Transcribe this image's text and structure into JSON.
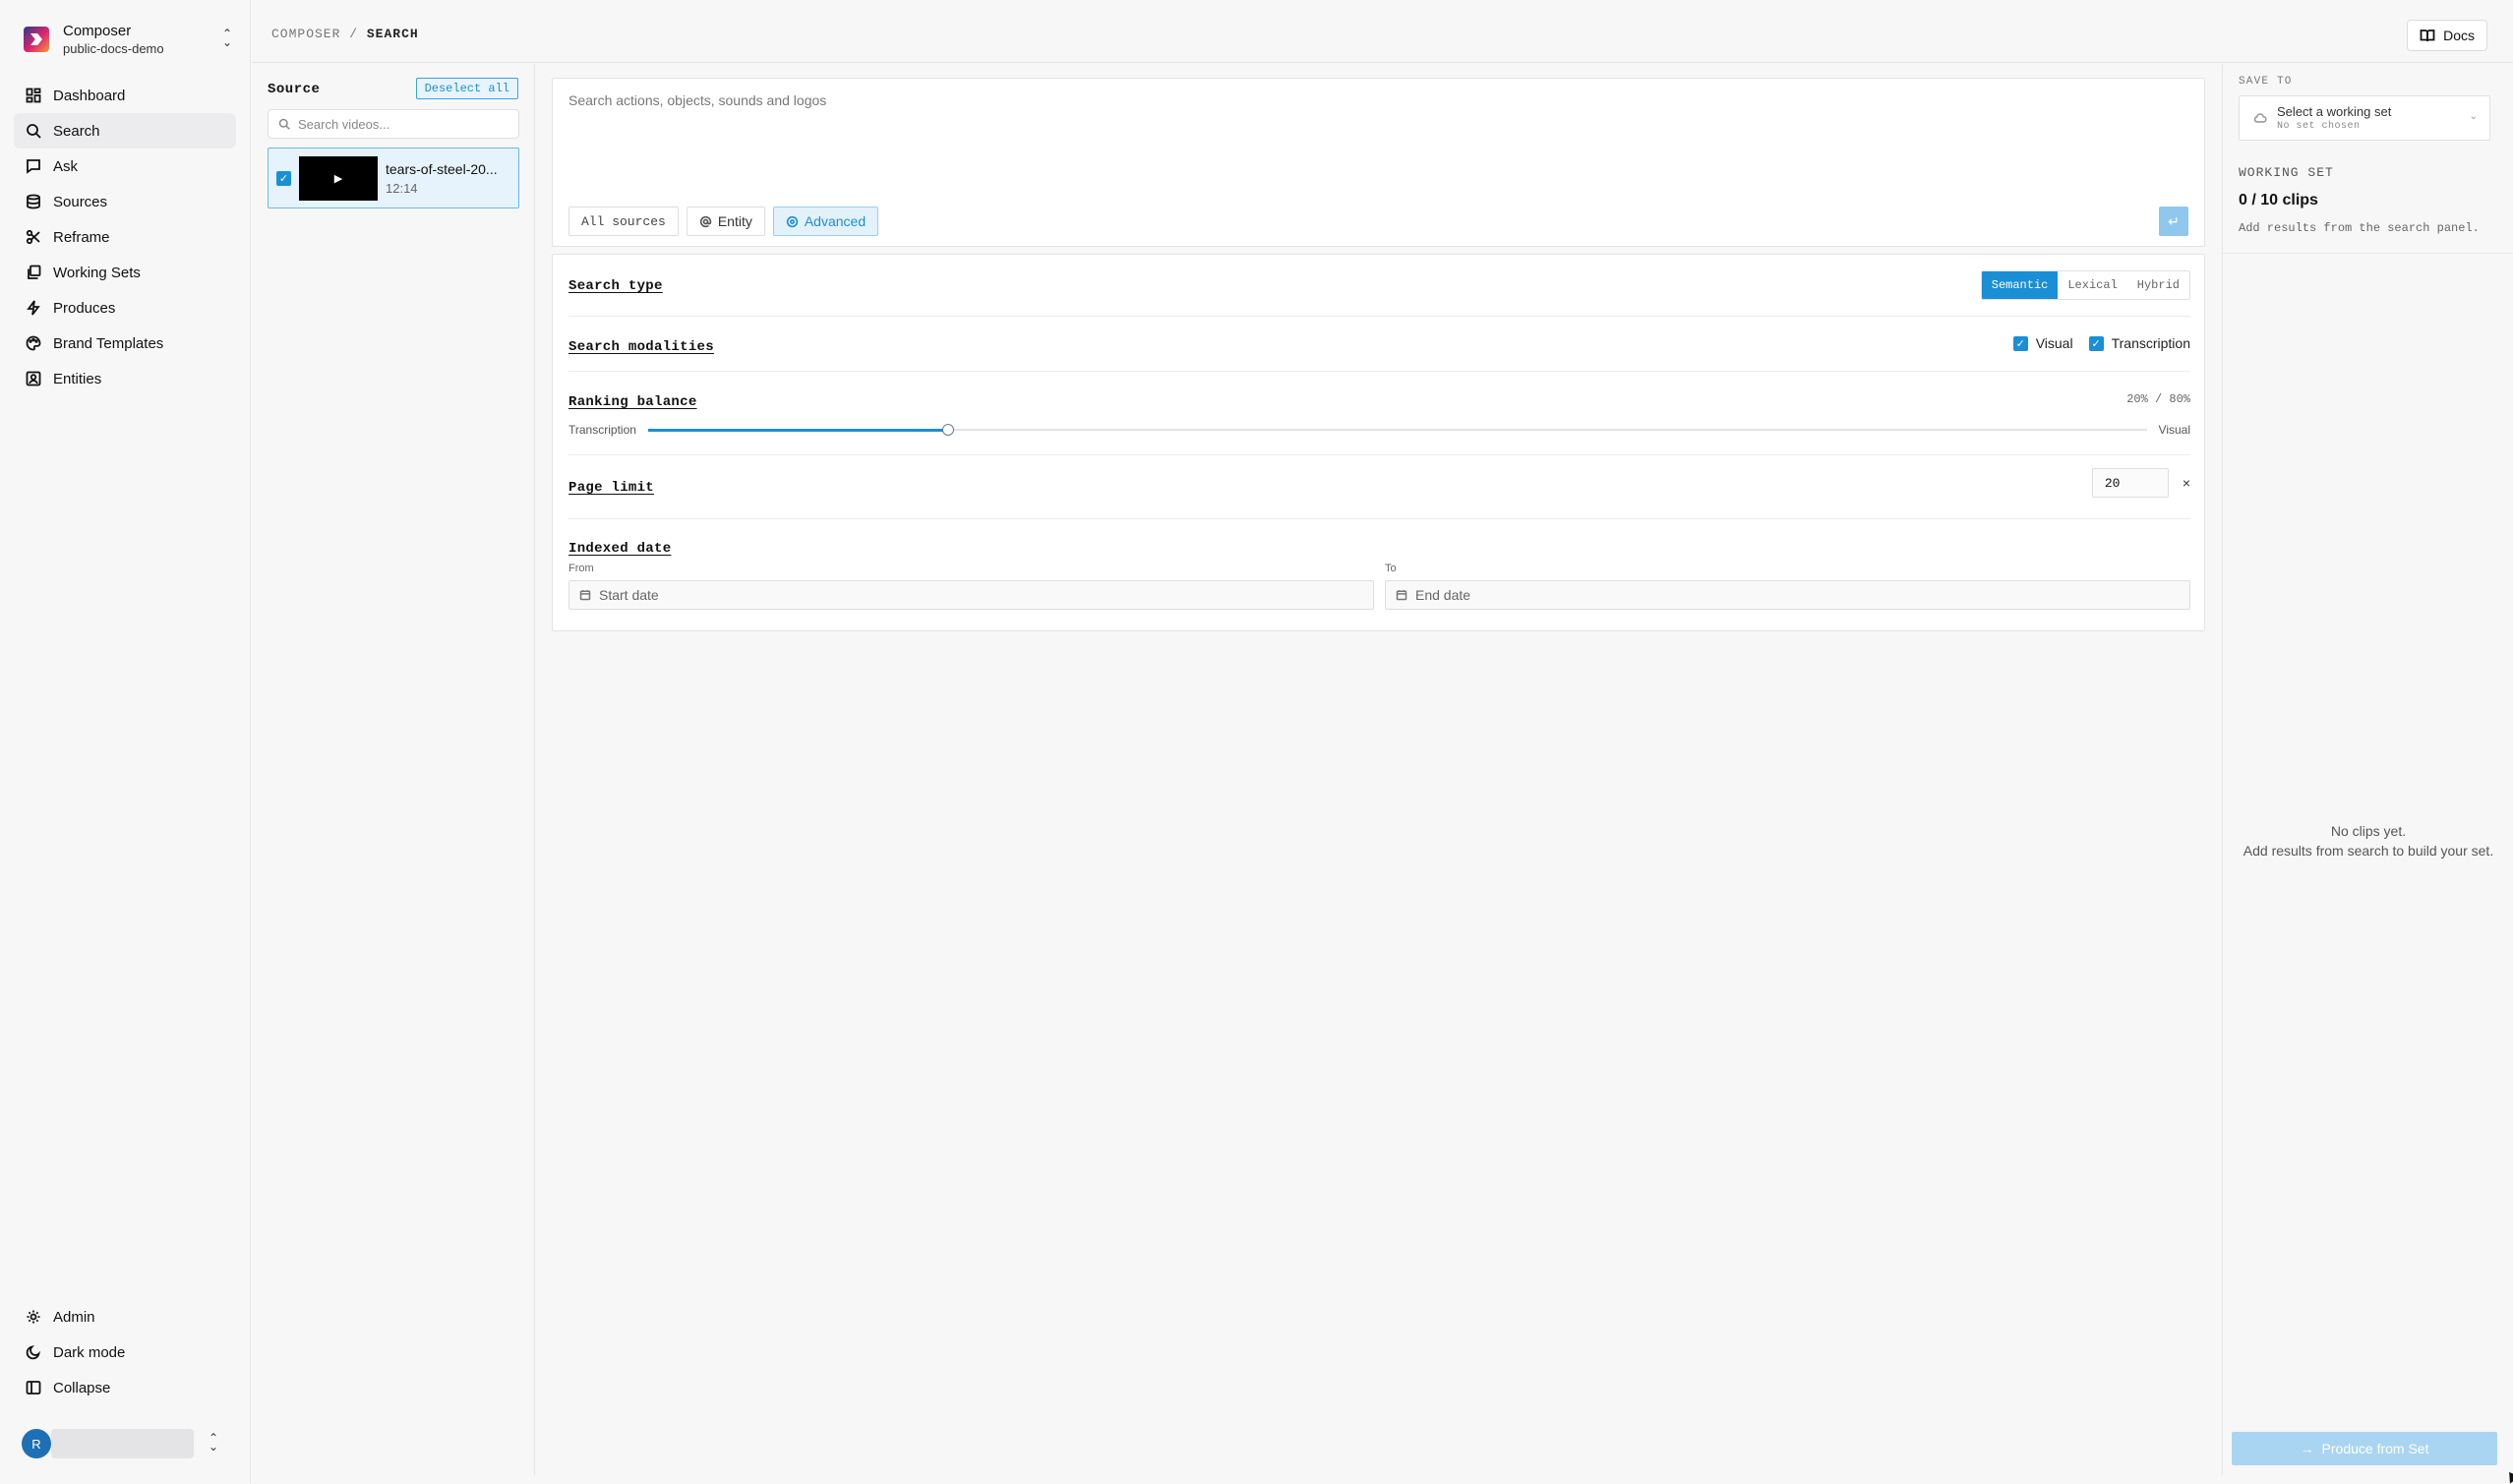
{
  "org": {
    "name": "Composer",
    "workspace": "public-docs-demo"
  },
  "nav": [
    {
      "label": "Dashboard",
      "icon": "dashboard-icon"
    },
    {
      "label": "Search",
      "icon": "search-icon",
      "active": true
    },
    {
      "label": "Ask",
      "icon": "chat-icon"
    },
    {
      "label": "Sources",
      "icon": "database-icon"
    },
    {
      "label": "Reframe",
      "icon": "scissors-icon"
    },
    {
      "label": "Working Sets",
      "icon": "layers-icon"
    },
    {
      "label": "Produces",
      "icon": "bolt-icon"
    },
    {
      "label": "Brand Templates",
      "icon": "palette-icon"
    },
    {
      "label": "Entities",
      "icon": "contact-icon"
    }
  ],
  "bottom_nav": [
    {
      "label": "Admin",
      "icon": "gear-icon"
    },
    {
      "label": "Dark mode",
      "icon": "moon-icon"
    },
    {
      "label": "Collapse",
      "icon": "sidebar-collapse-icon"
    }
  ],
  "user": {
    "initial": "R"
  },
  "breadcrumb": {
    "root": "COMPOSER",
    "separator": "/",
    "current": "SEARCH"
  },
  "header": {
    "docs_label": "Docs"
  },
  "source": {
    "title": "Source",
    "deselect_label": "Deselect all",
    "search_placeholder": "Search videos...",
    "videos": [
      {
        "name": "tears-of-steel-20...",
        "duration": "12:14",
        "selected": true
      }
    ]
  },
  "query": {
    "placeholder": "Search actions, objects, sounds and logos",
    "chips": {
      "all_sources": "All sources",
      "entity": "Entity",
      "advanced": "Advanced"
    }
  },
  "advanced": {
    "search_type": {
      "label": "Search type",
      "options": [
        "Semantic",
        "Lexical",
        "Hybrid"
      ],
      "selected": "Semantic"
    },
    "modalities": {
      "label": "Search modalities",
      "visual": "Visual",
      "transcription": "Transcription"
    },
    "ranking": {
      "label": "Ranking balance",
      "ratio_text": "20% / 80%",
      "left": "Transcription",
      "right": "Visual",
      "value": 0.2
    },
    "page_limit": {
      "label": "Page limit",
      "value": "20",
      "clear": "×"
    },
    "indexed_date": {
      "label": "Indexed date",
      "from_label": "From",
      "to_label": "To",
      "start_placeholder": "Start date",
      "end_placeholder": "End date"
    }
  },
  "right_panel": {
    "save_to": "SAVE TO",
    "select_title": "Select a working set",
    "select_sub": "No set chosen",
    "working_set_heading": "WORKING SET",
    "count": "0 / 10 clips",
    "hint": "Add results from the search panel.",
    "empty_line1": "No clips yet.",
    "empty_line2": "Add results from search to build your set.",
    "produce_label": "Produce from Set"
  },
  "colors": {
    "accent": "#1a8fd6",
    "accent_light": "#e3f1fb",
    "produce_disabled": "#a9d5f2"
  }
}
